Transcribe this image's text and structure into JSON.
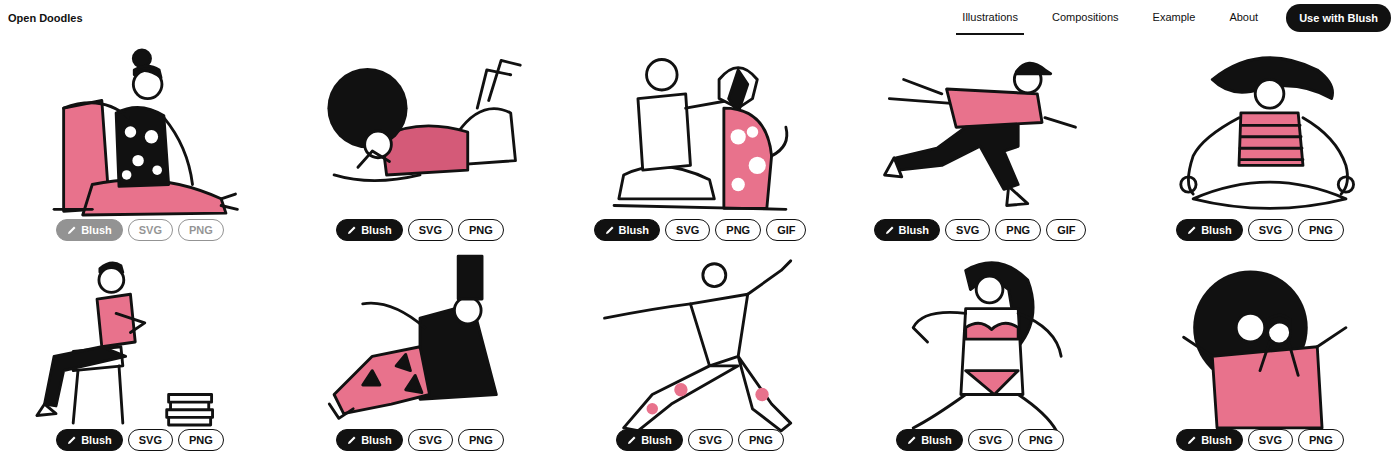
{
  "site": {
    "title": "Open Doodles"
  },
  "nav": {
    "items": [
      {
        "label": "Illustrations",
        "selected": true
      },
      {
        "label": "Compositions",
        "selected": false
      },
      {
        "label": "Example",
        "selected": false
      },
      {
        "label": "About",
        "selected": false
      }
    ],
    "cta": "Use with Blush"
  },
  "illustrations": [
    {
      "faded": true,
      "buttons": [
        {
          "label": "Blush",
          "kind": "primary"
        },
        {
          "label": "SVG",
          "kind": "outline"
        },
        {
          "label": "PNG",
          "kind": "outline"
        }
      ]
    },
    {
      "faded": false,
      "buttons": [
        {
          "label": "Blush",
          "kind": "primary"
        },
        {
          "label": "SVG",
          "kind": "outline"
        },
        {
          "label": "PNG",
          "kind": "outline"
        }
      ]
    },
    {
      "faded": false,
      "buttons": [
        {
          "label": "Blush",
          "kind": "primary"
        },
        {
          "label": "SVG",
          "kind": "outline"
        },
        {
          "label": "PNG",
          "kind": "outline"
        },
        {
          "label": "GIF",
          "kind": "outline"
        }
      ]
    },
    {
      "faded": false,
      "buttons": [
        {
          "label": "Blush",
          "kind": "primary"
        },
        {
          "label": "SVG",
          "kind": "outline"
        },
        {
          "label": "PNG",
          "kind": "outline"
        },
        {
          "label": "GIF",
          "kind": "outline"
        }
      ]
    },
    {
      "faded": false,
      "buttons": [
        {
          "label": "Blush",
          "kind": "primary"
        },
        {
          "label": "SVG",
          "kind": "outline"
        },
        {
          "label": "PNG",
          "kind": "outline"
        }
      ]
    },
    {
      "faded": false,
      "buttons": [
        {
          "label": "Blush",
          "kind": "primary"
        },
        {
          "label": "SVG",
          "kind": "outline"
        },
        {
          "label": "PNG",
          "kind": "outline"
        }
      ]
    },
    {
      "faded": false,
      "buttons": [
        {
          "label": "Blush",
          "kind": "primary"
        },
        {
          "label": "SVG",
          "kind": "outline"
        },
        {
          "label": "PNG",
          "kind": "outline"
        }
      ]
    },
    {
      "faded": false,
      "buttons": [
        {
          "label": "Blush",
          "kind": "primary"
        },
        {
          "label": "SVG",
          "kind": "outline"
        },
        {
          "label": "PNG",
          "kind": "outline"
        }
      ]
    },
    {
      "faded": false,
      "buttons": [
        {
          "label": "Blush",
          "kind": "primary"
        },
        {
          "label": "SVG",
          "kind": "outline"
        },
        {
          "label": "PNG",
          "kind": "outline"
        }
      ]
    },
    {
      "faded": false,
      "buttons": [
        {
          "label": "Blush",
          "kind": "primary"
        },
        {
          "label": "SVG",
          "kind": "outline"
        },
        {
          "label": "PNG",
          "kind": "outline"
        }
      ]
    }
  ]
}
